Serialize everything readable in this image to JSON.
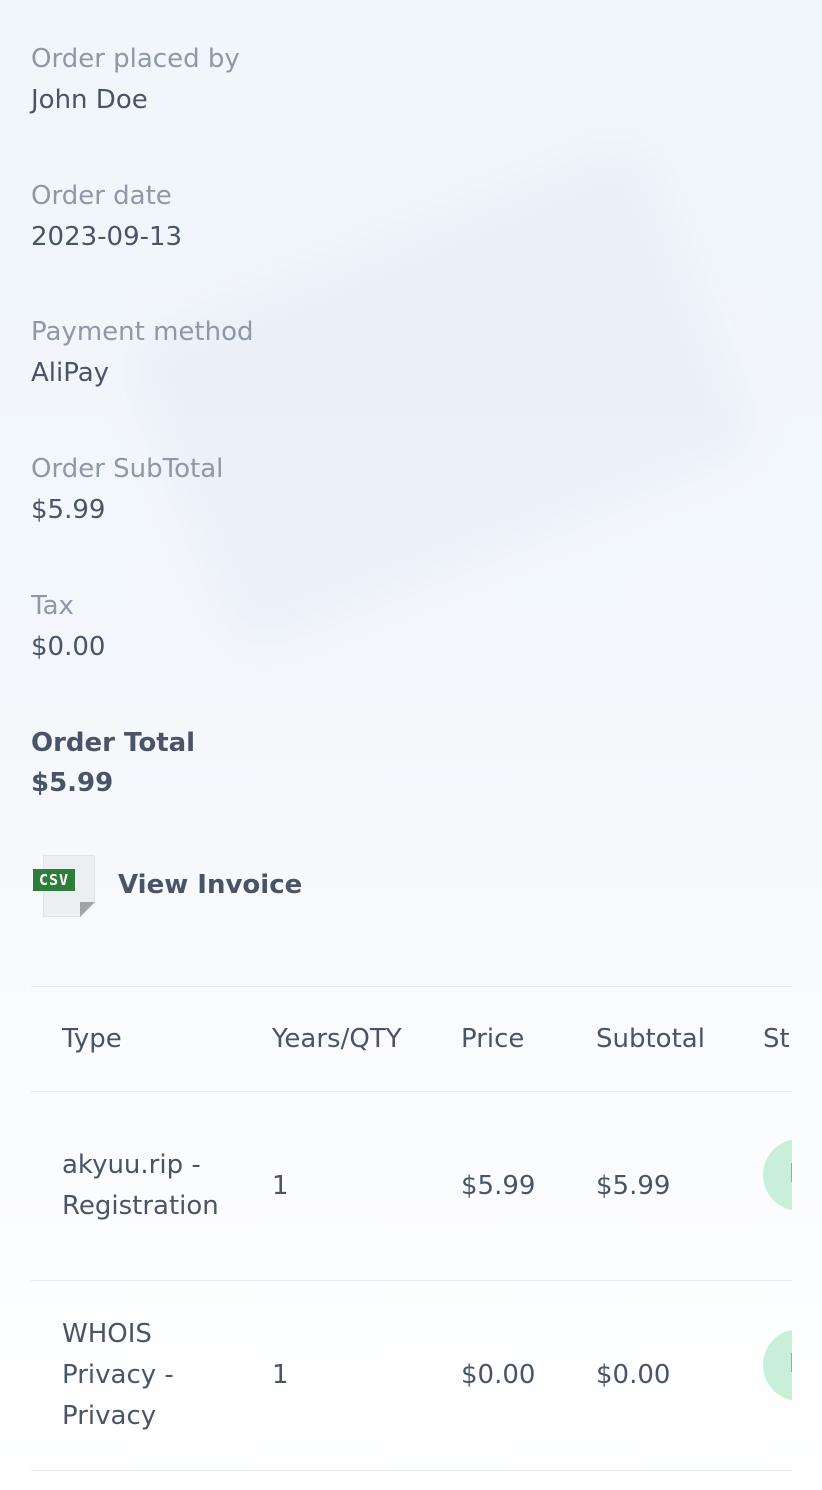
{
  "details": {
    "placed_by_label": "Order placed by",
    "placed_by_value": "John Doe",
    "date_label": "Order date",
    "date_value": "2023-09-13",
    "payment_label": "Payment method",
    "payment_value": "AliPay",
    "subtotal_label": "Order SubTotal",
    "subtotal_value": "$5.99",
    "tax_label": "Tax",
    "tax_value": "$0.00",
    "total_label": "Order Total",
    "total_value": "$5.99"
  },
  "invoice": {
    "icon_text": "CSV",
    "icon": "csv-file-icon",
    "link_label": "View Invoice"
  },
  "table": {
    "headers": [
      "Type",
      "Years/QTY",
      "Price",
      "Subtotal",
      "St"
    ],
    "rows": [
      {
        "type_line1": "akyuu.rip -",
        "type_line2": "Registration",
        "qty": "1",
        "price": "$5.99",
        "subtotal": "$5.99",
        "status_char": "I"
      },
      {
        "type_line1": "WHOIS",
        "type_line2": "Privacy -",
        "type_line3": "Privacy",
        "qty": "1",
        "price": "$0.00",
        "subtotal": "$0.00",
        "status_char": "I"
      }
    ]
  },
  "colors": {
    "text": "#4a5468",
    "label": "#8e98a8",
    "csv_green": "#2f7d3a",
    "status_bg": "#c8f0d8"
  }
}
